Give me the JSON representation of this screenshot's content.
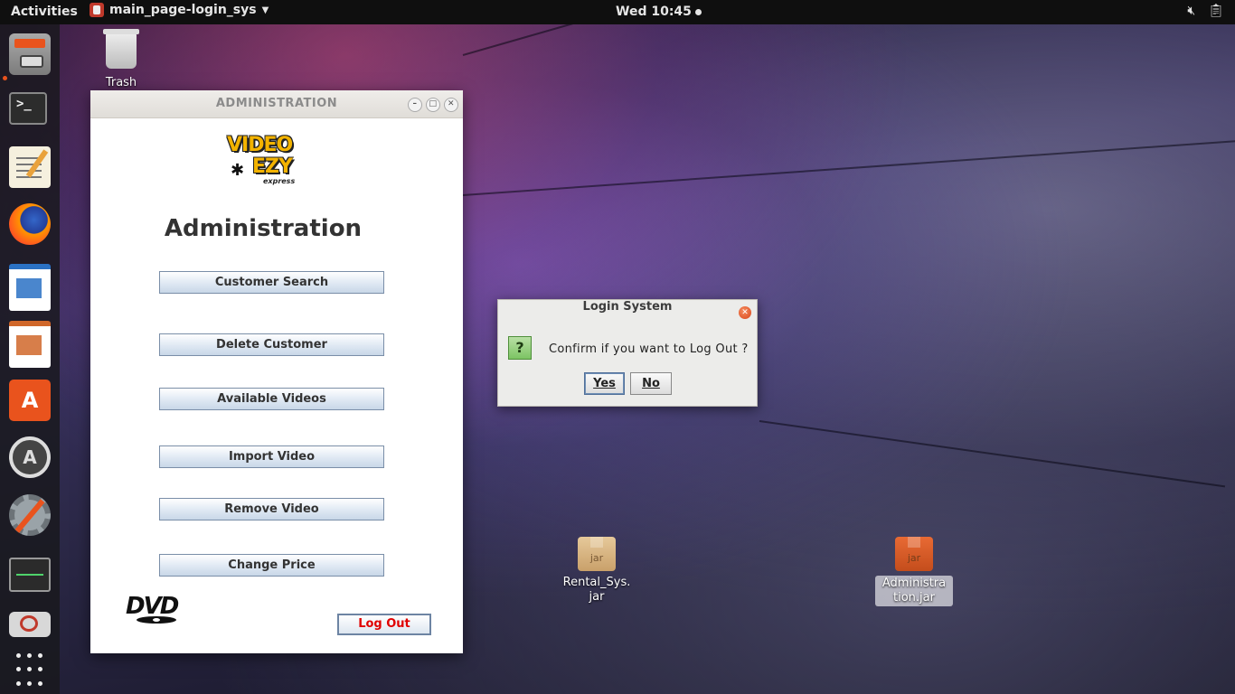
{
  "topbar": {
    "activities": "Activities",
    "app_name": "main_page-login_sys",
    "clock": "Wed 10:45",
    "tray_icons": [
      "speaker-muted-icon",
      "clipboard-icon"
    ]
  },
  "dock": {
    "items": [
      "files",
      "terminal",
      "text-editor",
      "firefox",
      "libreoffice-writer",
      "libreoffice-impress",
      "software-center",
      "software-updater",
      "settings",
      "system-monitor",
      "screen-recorder",
      "show-applications"
    ],
    "terminal_prompt": ">_"
  },
  "desktop": {
    "trash_label": "Trash",
    "jar_badge": "jar",
    "rental_label_1": "Rental_Sys.",
    "rental_label_2": "jar",
    "admin_label_1": "Administra",
    "admin_label_2": "tion.jar"
  },
  "admin_window": {
    "title": "ADMINISTRATION",
    "logo_line1": "VIDEO",
    "logo_line2": "EZY",
    "logo_line3": "express",
    "heading": "Administration",
    "buttons": {
      "customer_search": "Customer Search",
      "delete_customer": "Delete Customer",
      "available_videos": "Available Videos",
      "import_video": "Import Video",
      "remove_video": "Remove Video",
      "change_price": "Change Price"
    },
    "dvd_logo": "DVD",
    "logout": "Log Out"
  },
  "dialog": {
    "title": "Login System",
    "icon": "?",
    "message": "Confirm if you want to Log Out ?",
    "yes": "Yes",
    "no": "No"
  },
  "colors": {
    "logout_text": "#e00000",
    "dock_running": "#e9531d"
  }
}
